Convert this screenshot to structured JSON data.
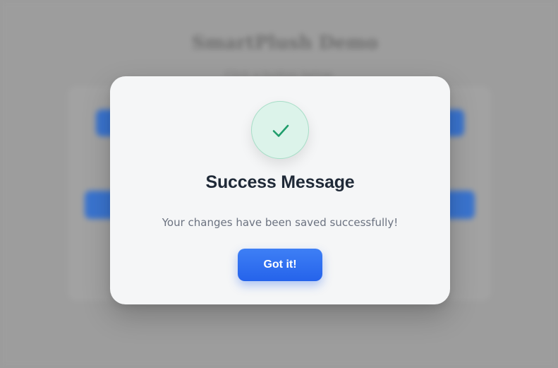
{
  "background": {
    "title": "SmartPlush Demo",
    "subtitle": "Click a button below"
  },
  "modal": {
    "icon": "check-icon",
    "title": "Success Message",
    "message": "Your changes have been saved successfully!",
    "confirm_label": "Got it!"
  },
  "colors": {
    "accent": "#2563eb",
    "success": "#1f9d6b",
    "success_bg": "#dcf3ea",
    "title": "#1f2937",
    "message": "#6b7280",
    "overlay": "#9c9c9c"
  }
}
